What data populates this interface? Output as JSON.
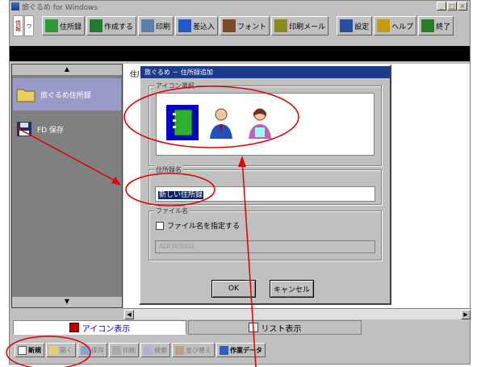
{
  "window": {
    "title": "旅ぐるめ  for Windows",
    "controls": [
      "_",
      "□",
      "×"
    ]
  },
  "toolbar": {
    "logo": [
      "情報",
      "ワ"
    ],
    "buttons": [
      {
        "label": "住所録",
        "icon": "address-book-icon",
        "color": "#2d9b3a"
      },
      {
        "label": "作成する",
        "icon": "create-icon",
        "color": "#1e7d2f"
      },
      {
        "label": "印刷",
        "icon": "print-icon",
        "color": "#5a7fb0"
      },
      {
        "label": "差込入",
        "icon": "insert-icon",
        "color": "#2458c9"
      },
      {
        "label": "フォント",
        "icon": "font-icon",
        "color": "#7a4a2a"
      },
      {
        "label": "印刷メール",
        "icon": "mail-icon",
        "color": "#8a8a20"
      },
      {
        "label": "設定",
        "icon": "settings-icon",
        "color": "#2a4fa0"
      },
      {
        "label": "ヘルプ",
        "icon": "help-icon",
        "color": "#c89a10"
      },
      {
        "label": "終了",
        "icon": "exit-icon",
        "color": "#2a7a2a"
      }
    ]
  },
  "left_panel": {
    "items": [
      {
        "label": "旅ぐるめ住所録",
        "icon": "folder-icon",
        "selected": true
      },
      {
        "label": "FD 保存",
        "icon": "floppy-icon",
        "selected": false
      }
    ]
  },
  "content": {
    "tab_label": "住所"
  },
  "tabs": [
    {
      "label": "アイコン表示",
      "icon": "icon-view-icon",
      "active": true
    },
    {
      "label": "リスト表示",
      "icon": "list-view-icon",
      "active": false
    }
  ],
  "bottom_buttons": [
    {
      "label": "新規",
      "active": true
    },
    {
      "label": "開く",
      "active": false
    },
    {
      "label": "保存",
      "active": false
    },
    {
      "label": "印刷",
      "active": false
    },
    {
      "label": "検索",
      "active": false
    },
    {
      "label": "並び替え",
      "active": false
    },
    {
      "label": "作業データ",
      "active": true
    }
  ],
  "dialog": {
    "title": "旅ぐるめ － 住所録追加",
    "icon_group_label": "アイコン選択",
    "icons": [
      "notebook-icon",
      "man-icon",
      "woman-icon"
    ],
    "name_group_label": "住所録名",
    "name_value": "新しい住所録",
    "file_group_label": "ファイル名",
    "file_checkbox_label": "ファイル名を指定する",
    "file_placeholder": "ADDR0000",
    "ok_label": "OK",
    "cancel_label": "キャンセル"
  },
  "annotations": {
    "color": "#e00000"
  }
}
